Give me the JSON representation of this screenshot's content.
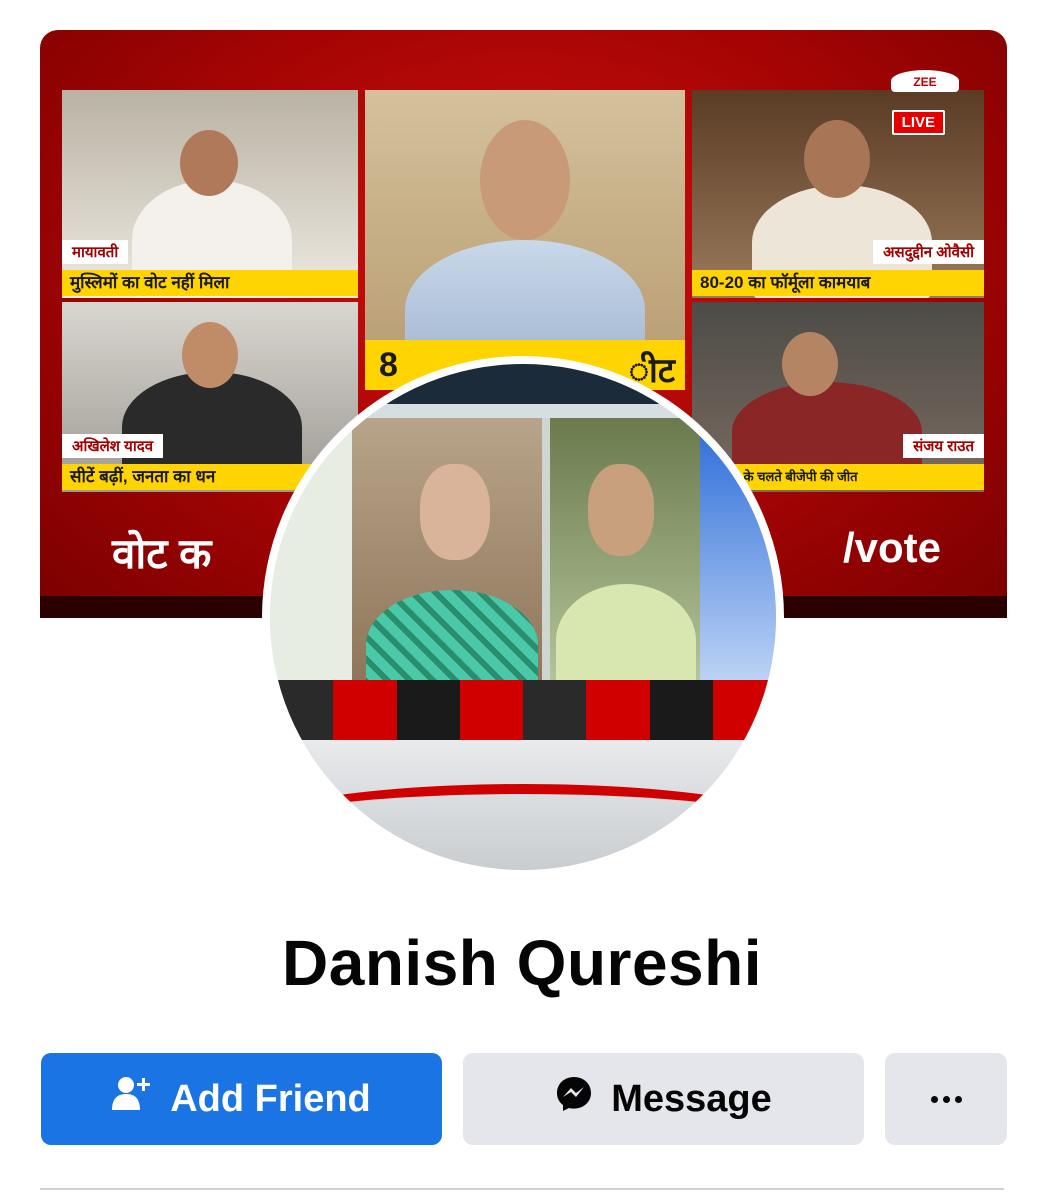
{
  "cover": {
    "channel_logo": "ZEE",
    "live_badge": "LIVE",
    "panels": {
      "top_left_name": "मायावती",
      "top_left_caption": "मुस्लिमों का वोट नहीं मिला",
      "center_caption_left": "8",
      "center_caption_right": "ीट",
      "top_right_name": "असदुद्दीन ओवैसी",
      "top_right_caption": "80-20 का फॉर्मूला कामयाब",
      "bottom_left_name": "अखिलेश यादव",
      "bottom_left_caption": "सीटें बढ़ीं, जनता का धन",
      "bottom_right_name": "संजय राउत",
      "bottom_right_caption": "मायावती के चलते बीजेपी की जीत"
    },
    "ticker_left": "वोट क",
    "ticker_right": "/vote"
  },
  "profile": {
    "name": "Danish Qureshi"
  },
  "actions": {
    "add_friend_label": "Add Friend",
    "add_friend_icon": "add-person-icon",
    "message_label": "Message",
    "message_icon": "messenger-icon",
    "more_icon": "more-dots-icon"
  },
  "colors": {
    "primary": "#1b74e4",
    "secondary_button": "#e4e6eb",
    "cover_red": "#b50606",
    "text": "#050505"
  }
}
